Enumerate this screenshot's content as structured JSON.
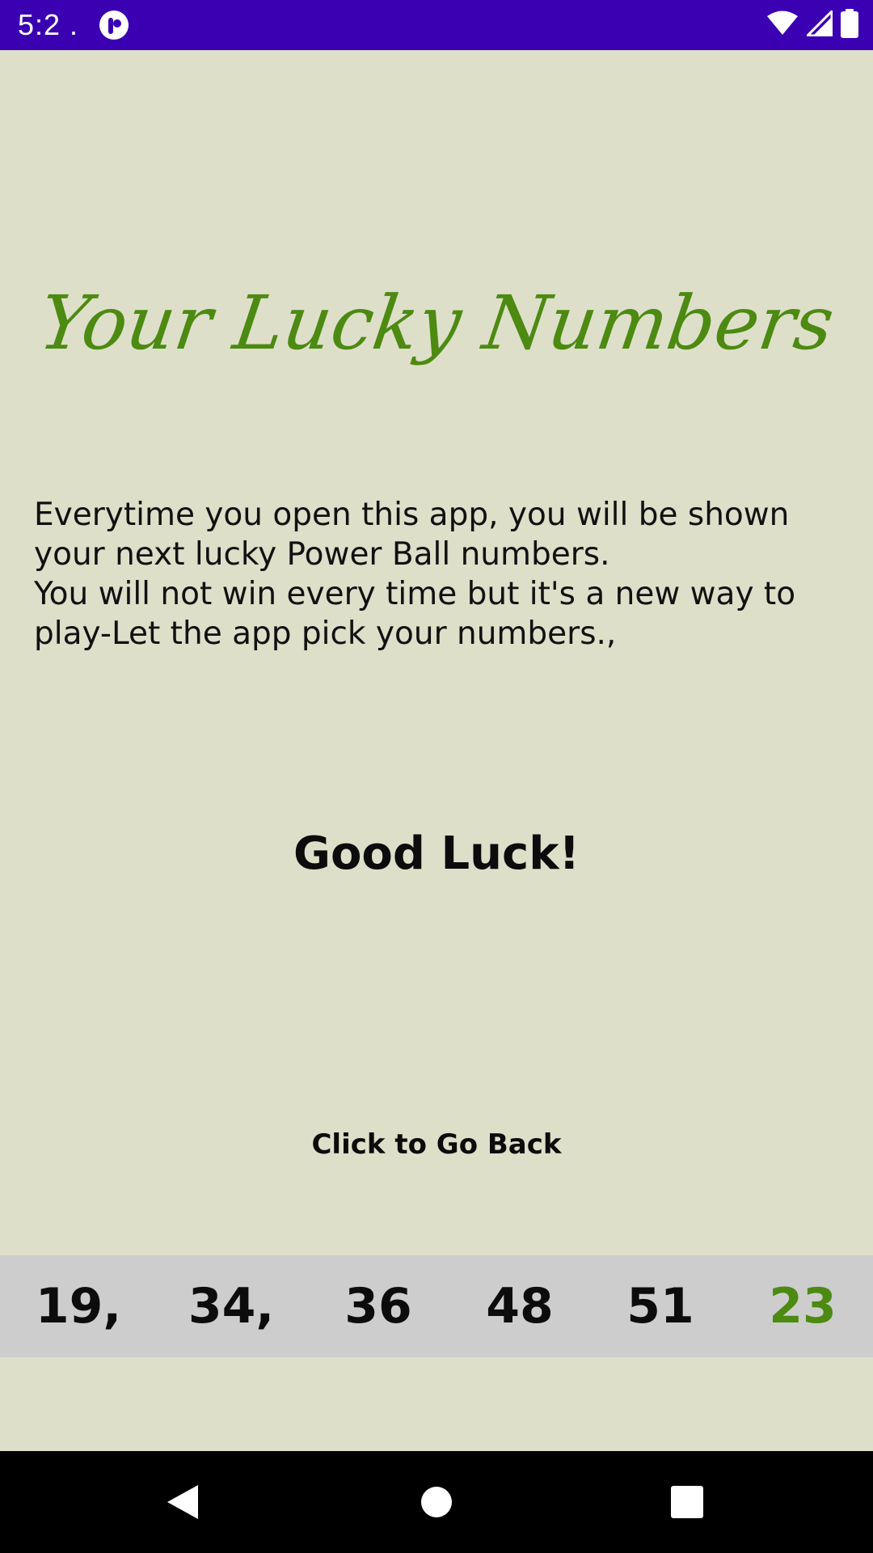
{
  "status_bar": {
    "time": "5:2 .",
    "app_icon": "app-notification-icon",
    "icons": [
      "wifi-icon",
      "signal-icon",
      "battery-icon"
    ],
    "background_color": "#3a00b2"
  },
  "screen": {
    "background_color": "#dedfc9",
    "title": "Your Lucky Numbers",
    "title_color": "#4c8a12",
    "description_lines": [
      "Everytime you open this app, you will be shown your next lucky Power Ball numbers.",
      "You will not win every time but it's a new way to play-Let the app pick your numbers.,"
    ],
    "good_luck": "Good Luck!",
    "back_button_label": "Click to Go Back"
  },
  "numbers": {
    "background_color": "#cdcdcd",
    "items": [
      "19,",
      "34,",
      "36",
      "48",
      "51",
      "23"
    ],
    "power_ball_color": "#4c8a12"
  },
  "nav_bar": {
    "buttons": [
      "back-icon",
      "home-icon",
      "recents-icon"
    ]
  }
}
